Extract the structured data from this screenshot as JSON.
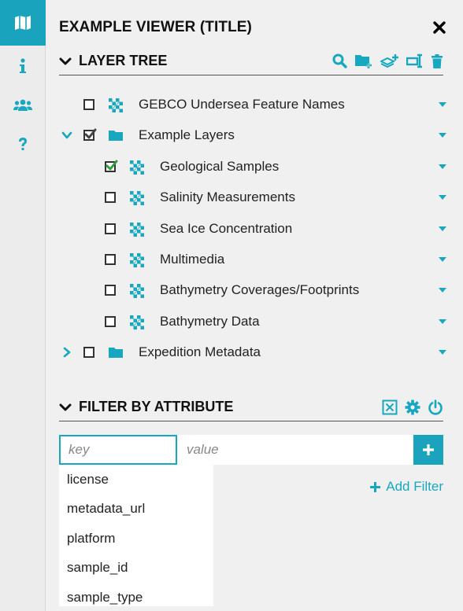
{
  "rail": {
    "items": [
      {
        "icon": "map-icon",
        "active": true
      },
      {
        "icon": "info-icon",
        "active": false
      },
      {
        "icon": "users-icon",
        "active": false
      },
      {
        "icon": "help-icon",
        "active": false
      }
    ]
  },
  "viewer": {
    "title": "EXAMPLE VIEWER (TITLE)"
  },
  "layer_tree": {
    "label": "LAYER TREE",
    "tools": [
      "search-icon",
      "add-folder-icon",
      "add-layer-icon",
      "text-cursor-icon",
      "trash-icon"
    ],
    "rows": [
      {
        "label": "GEBCO Undersea Feature Names",
        "type": "layer",
        "checked": false,
        "expander": "none",
        "level": 0
      },
      {
        "label": "Example Layers",
        "type": "folder",
        "checked": true,
        "expander": "expanded",
        "level": 0
      },
      {
        "label": "Geological Samples",
        "type": "layer",
        "checked": true,
        "expander": "none",
        "level": 1
      },
      {
        "label": "Salinity Measurements",
        "type": "layer",
        "checked": false,
        "expander": "none",
        "level": 1
      },
      {
        "label": "Sea Ice Concentration",
        "type": "layer",
        "checked": false,
        "expander": "none",
        "level": 1
      },
      {
        "label": "Multimedia",
        "type": "layer",
        "checked": false,
        "expander": "none",
        "level": 1
      },
      {
        "label": "Bathymetry Coverages/Footprints",
        "type": "layer",
        "checked": false,
        "expander": "none",
        "level": 1
      },
      {
        "label": "Bathymetry Data",
        "type": "layer",
        "checked": false,
        "expander": "none",
        "level": 1
      },
      {
        "label": "Expedition Metadata",
        "type": "folder",
        "checked": false,
        "expander": "collapsed",
        "level": 0
      }
    ]
  },
  "filter": {
    "label": "FILTER BY ATTRIBUTE",
    "key_placeholder": "key",
    "value_placeholder": "value",
    "add_filter_label": "Add Filter",
    "suggestions": [
      "license",
      "metadata_url",
      "platform",
      "sample_id",
      "sample_type"
    ]
  },
  "colors": {
    "accent": "#17a8c0",
    "accent_dark": "#1aa3bc",
    "check_green": "#2e9e3a"
  }
}
